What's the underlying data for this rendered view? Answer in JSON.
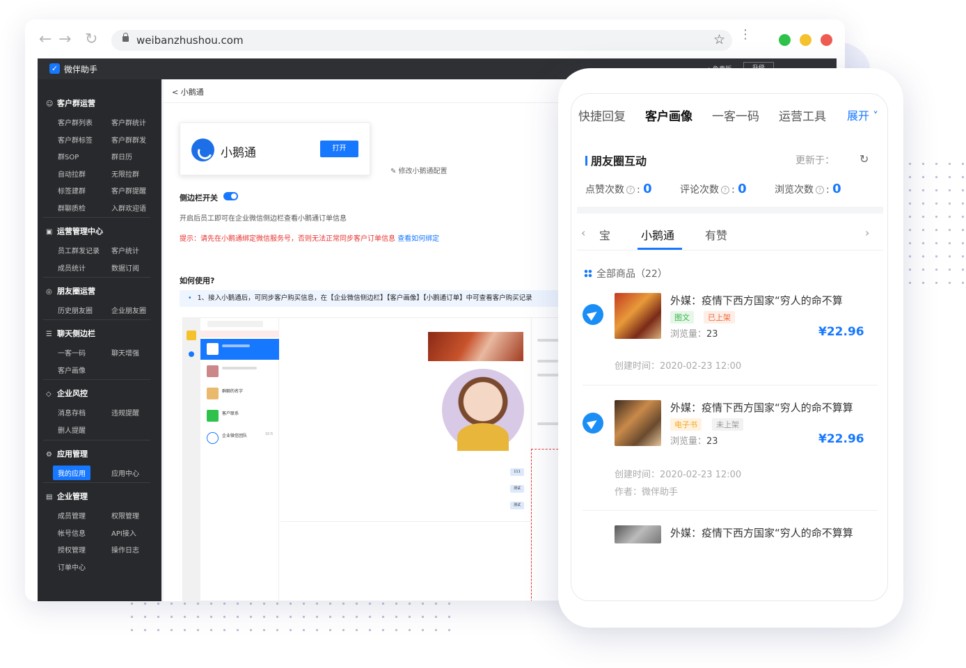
{
  "browser": {
    "url": "weibanzhushou.com",
    "back_icon": "arrow-left-icon",
    "forward_icon": "arrow-right-icon",
    "reload_icon": "reload-icon",
    "traffic_lights": [
      "#2ec24a",
      "#f5c22e",
      "#ee5b52"
    ]
  },
  "app": {
    "name": "微伴助手",
    "topbar_hint": "• 免费版",
    "upgrade": "升级"
  },
  "sidebar": {
    "groups": [
      {
        "label": "客户群运营",
        "items": [
          "客户群列表",
          "客户群统计",
          "客户群标签",
          "客户群群发",
          "群SOP",
          "群日历",
          "自动拉群",
          "无限拉群",
          "标签建群",
          "客户群提醒",
          "群聊质检",
          "入群欢迎语"
        ]
      },
      {
        "label": "运营管理中心",
        "items": [
          "员工群发记录",
          "客户统计",
          "成员统计",
          "数据订阅"
        ]
      },
      {
        "label": "朋友圈运营",
        "items": [
          "历史朋友圈",
          "企业朋友圈"
        ]
      },
      {
        "label": "聊天侧边栏",
        "items": [
          "一客一码",
          "聊天增强",
          "客户画像"
        ]
      },
      {
        "label": "企业风控",
        "items": [
          "消息存档",
          "违规提醒",
          "删人提醒"
        ]
      },
      {
        "label": "应用管理",
        "items": [
          "我的应用",
          "应用中心"
        ]
      },
      {
        "label": "企业管理",
        "items": [
          "成员管理",
          "权限管理",
          "帐号信息",
          "API接入",
          "授权管理",
          "操作日志",
          "订单中心"
        ]
      }
    ]
  },
  "content": {
    "breadcrumb": "< 小鹅通",
    "app_card_title": "小鹅通",
    "open_button": "打开",
    "edit_link": "✎ 修改小鹅通配置",
    "switch_label": "侧边栏开关",
    "switch_on": true,
    "description": "开启后员工即可在企业微信侧边栏查看小鹅通订单信息",
    "tip": "提示：请先在小鹅通绑定微信服务号，否则无法正常同步客户订单信息",
    "tip_link": "查看如何绑定",
    "howto_title": "如何使用?",
    "step1": "1、接入小鹅通后，可同步客户购买信息，在【企业微信侧边栏】【客户画像】【小鹅通订单】中可查看客户购买记录",
    "mock": {
      "rows": [
        {
          "name": "企业微信团队",
          "time": "10:5"
        },
        {
          "name": "客户联系",
          "time": ""
        },
        {
          "name": "群聊的名字",
          "time": ""
        }
      ],
      "bubbles": [
        "111",
        "测试",
        "测试"
      ]
    }
  },
  "phone": {
    "tabs": [
      "快捷回复",
      "客户画像",
      "一客一码",
      "运营工具"
    ],
    "active_tab": 1,
    "expand": "展开 ˅",
    "section_title": "朋友圈互动",
    "update_label": "更新于：",
    "stats": [
      {
        "label": "点赞次数",
        "value": "0"
      },
      {
        "label": "评论次数",
        "value": "0"
      },
      {
        "label": "浏览次数",
        "value": "0"
      }
    ],
    "sub_tabs": [
      "宝",
      "小鹅通",
      "有赞"
    ],
    "active_sub_tab": 1,
    "all_goods": "全部商品（22）",
    "products": [
      {
        "title": "外媒：疫情下西方国家“穷人的命不算",
        "tags": [
          {
            "text": "图文",
            "bg": "#e6f7e9",
            "color": "#3ab54a"
          },
          {
            "text": "已上架",
            "bg": "#fdeee8",
            "color": "#f06c3a"
          }
        ],
        "views_label": "浏览量：",
        "views": "23",
        "price": "¥22.96",
        "created": "创建时间：2020-02-23 12:00",
        "author": ""
      },
      {
        "title": "外媒：疫情下西方国家“穷人的命不算算",
        "tags": [
          {
            "text": "电子书",
            "bg": "#fff3e0",
            "color": "#f5a623"
          },
          {
            "text": "未上架",
            "bg": "#f2f2f2",
            "color": "#999999"
          }
        ],
        "views_label": "浏览量：",
        "views": "23",
        "price": "¥22.96",
        "created": "创建时间：2020-02-23 12:00",
        "author": "作者：微伴助手"
      },
      {
        "title": "外媒：疫情下西方国家“穷人的命不算算",
        "tags": [],
        "views_label": "",
        "views": "",
        "price": "",
        "created": "",
        "author": ""
      }
    ]
  }
}
